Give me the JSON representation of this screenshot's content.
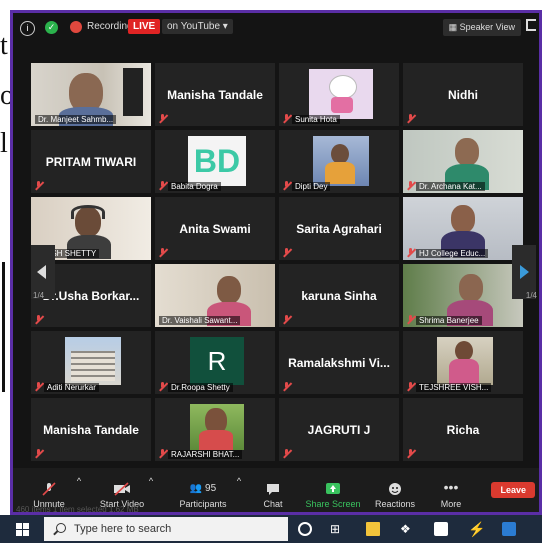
{
  "background_fragments": [
    "t",
    "o",
    "l",
    ""
  ],
  "topbar": {
    "info_icon": "i",
    "recording_label": "Recording",
    "live_label": "LIVE",
    "stream_label": "on YouTube ▾",
    "speaker_view_label": "Speaker View"
  },
  "tiles": [
    {
      "name": "Dr. Manjeet Sahmb...",
      "type": "video"
    },
    {
      "name": "Manisha Tandale",
      "type": "name"
    },
    {
      "name": "Sunita Hota",
      "type": "video"
    },
    {
      "name": "Nidhi",
      "type": "name"
    },
    {
      "name": "PRITAM TIWARI",
      "type": "name"
    },
    {
      "name": "Babita Dogra",
      "type": "video",
      "avatar_text": "BD"
    },
    {
      "name": "Dipti Dey",
      "type": "video"
    },
    {
      "name": "Dr. Archana Kat...",
      "type": "video"
    },
    {
      "name": "ARISH SHETTY",
      "type": "video"
    },
    {
      "name": "Anita Swami",
      "type": "name"
    },
    {
      "name": "Sarita Agrahari",
      "type": "name"
    },
    {
      "name": "HJ College Educ...",
      "type": "video"
    },
    {
      "name": "Dr.Usha Borkar...",
      "type": "name"
    },
    {
      "name": "Dr. Vaishali Sawant...",
      "type": "video"
    },
    {
      "name": "karuna Sinha",
      "type": "name"
    },
    {
      "name": "Shrima Banerjee",
      "type": "video"
    },
    {
      "name": "Aditi Nerurkar",
      "type": "video"
    },
    {
      "name": "Dr.Roopa Shetty",
      "type": "video",
      "avatar_text": "R"
    },
    {
      "name": "Ramalakshmi Vi...",
      "type": "name"
    },
    {
      "name": "TEJSHREE VISH...",
      "type": "video"
    },
    {
      "name": "Manisha Tandale",
      "type": "name"
    },
    {
      "name": "RAJARSHI BHAT...",
      "type": "video"
    },
    {
      "name": "JAGRUTI J",
      "type": "name"
    },
    {
      "name": "Richa",
      "type": "name"
    }
  ],
  "pagination": {
    "left": "1/4",
    "right": "1/4"
  },
  "controls": {
    "unmute": "Unmute",
    "start_video": "Start Video",
    "participants": "Participants",
    "participant_count": "95",
    "chat": "Chat",
    "share_screen": "Share Screen",
    "reactions": "Reactions",
    "more": "More",
    "leave": "Leave"
  },
  "behind_window_text": "460 items    1 item selected  1.62 MB",
  "taskbar": {
    "search_placeholder": "Type here to search"
  },
  "colors": {
    "accent_purple": "#5a2ea6",
    "live_red": "#e02424",
    "share_green": "#39c25e",
    "leave_red": "#d93a2f",
    "active_outline": "#b6e23a"
  }
}
